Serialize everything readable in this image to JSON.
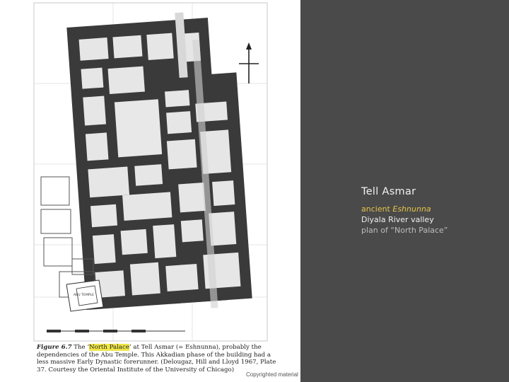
{
  "slide": {
    "title": "Tell Asmar",
    "ancient_prefix": "ancient ",
    "ancient_name": "Eshnunna",
    "region": "Diyala River valley",
    "plan_label": "plan of “North Palace”"
  },
  "figure": {
    "fig_label": "Figure 6.7",
    "caption_pre": " The ‘",
    "caption_highlight": "North Palace",
    "caption_post": "’ at Tell Asmar (= Eshnunna), probably the dependencies of the Abu Temple. This Akkadian phase of the building had a less massive Early Dynastic forerunner. (Delougaz, Hill and Lloyd 1967, Plate 37. Courtesy the Oriental Institute of the University of Chicago)",
    "abu_temple_label": "ABU TEMPLE",
    "copyright": "Copyrighted material"
  },
  "colors": {
    "background": "#4a4a4a",
    "title": "#f2f2f2",
    "ancient_accent": "#e2c24a",
    "caption_highlight": "#f0e64a",
    "wall": "#3a3a3a"
  }
}
